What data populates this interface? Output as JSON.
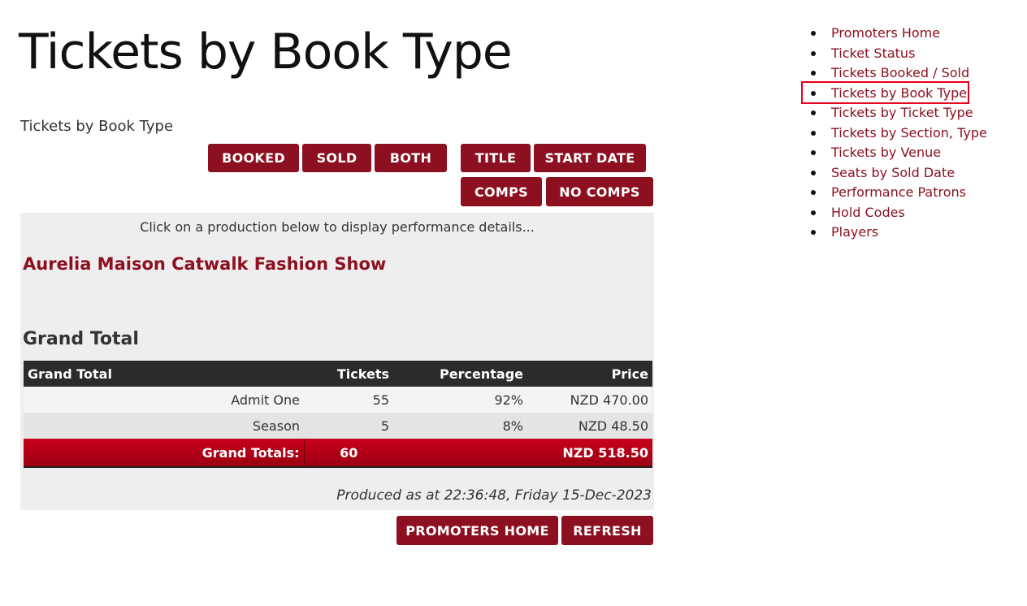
{
  "page": {
    "title": "Tickets by Book Type",
    "subtitle": "Tickets by Book Type"
  },
  "filters": {
    "booked": "BOOKED",
    "sold": "SOLD",
    "both": "BOTH",
    "title": "TITLE",
    "start_date": "START DATE",
    "comps": "COMPS",
    "no_comps": "NO COMPS"
  },
  "panel": {
    "hint": "Click on a production below to display performance details...",
    "production": "Aurelia Maison Catwalk Fashion Show",
    "grand_heading": "Grand Total",
    "table": {
      "headers": [
        "Grand Total",
        "Tickets",
        "Percentage",
        "Price"
      ],
      "rows": [
        {
          "label": "Admit One",
          "tickets": "55",
          "percentage": "92%",
          "price": "NZD 470.00"
        },
        {
          "label": "Season",
          "tickets": "5",
          "percentage": "8%",
          "price": "NZD 48.50"
        }
      ],
      "totals": {
        "label": "Grand Totals:",
        "tickets": "60",
        "price": "NZD 518.50"
      }
    },
    "produced": "Produced as at 22:36:48, Friday 15-Dec-2023"
  },
  "actions": {
    "promoters_home": "PROMOTERS HOME",
    "refresh": "REFRESH"
  },
  "nav": {
    "items": [
      "Promoters Home",
      "Ticket Status",
      "Tickets Booked / Sold",
      "Tickets by Book Type",
      "Tickets by Ticket Type",
      "Tickets by Section, Type",
      "Tickets by Venue",
      "Seats by Sold Date",
      "Performance Patrons",
      "Hold Codes",
      "Players"
    ],
    "active": "Tickets by Book Type"
  },
  "colors": {
    "brand": "#8c1020",
    "highlight": "#e8001c",
    "header_bg": "#2b2b2b"
  }
}
